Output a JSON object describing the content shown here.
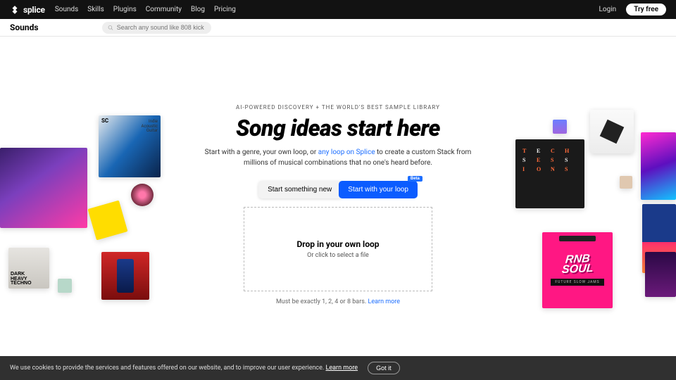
{
  "topbar": {
    "logo": "splice",
    "nav": [
      "Sounds",
      "Skills",
      "Plugins",
      "Community",
      "Blog",
      "Pricing"
    ],
    "login": "Login",
    "try_free": "Try free"
  },
  "subnav": {
    "title": "Sounds",
    "search_placeholder": "Search any sound like 808 kick"
  },
  "hero": {
    "eyebrow": "AI-POWERED DISCOVERY + THE WORLD'S BEST SAMPLE LIBRARY",
    "headline": "Song ideas start here",
    "subtext_pre": "Start with a genre, your own loop, or ",
    "subtext_link": "any loop on Splice",
    "subtext_post": " to create a custom Stack from millions of musical combinations that no one's heard before.",
    "cta_white": "Start something new",
    "cta_blue": "Start with your loop",
    "beta": "Beta"
  },
  "dropzone": {
    "title": "Drop in your own loop",
    "sub": "Or click to select a file",
    "bars_pre": "Must be exactly 1, 2, 4 or 8 bars. ",
    "bars_link": "Learn more"
  },
  "cookie": {
    "text": "We use cookies to provide the services and features offered on our website, and to improve our user experience. ",
    "learn": "Learn more",
    "got_it": "Got it"
  },
  "art_labels": {
    "indie": "Indie\nAcoustic\nGuitar",
    "sc": "SC",
    "dark": "DARK",
    "heavy": "HEAVY",
    "techno": "TECHNO",
    "tech_sessions": [
      "T",
      "E",
      "C",
      "H",
      "S",
      "E",
      "S",
      "S",
      "I",
      "O",
      "N",
      "S"
    ],
    "rnb1": "RNB",
    "rnb2": "SOUL",
    "rnb_strip": "FUTURE SLOW JAMS"
  }
}
